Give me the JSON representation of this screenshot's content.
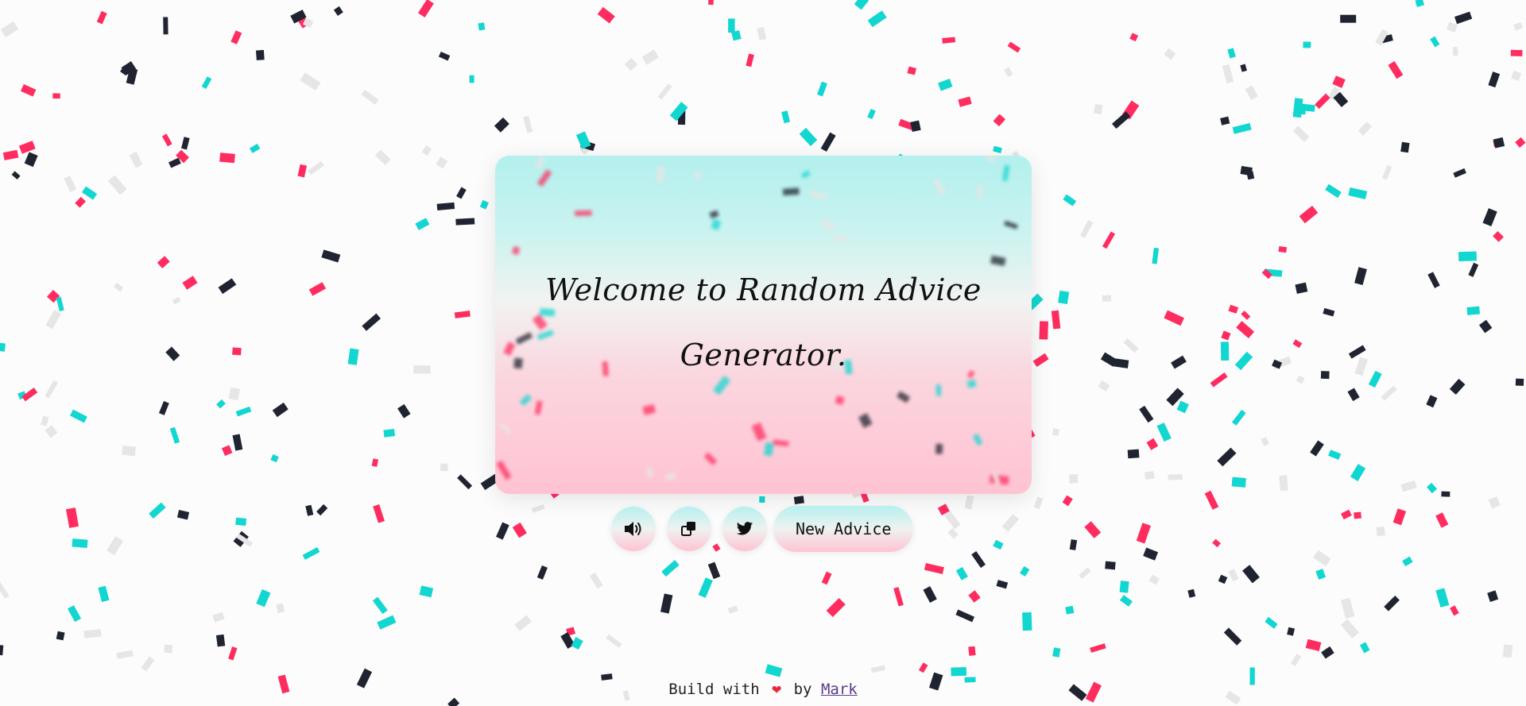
{
  "advice": {
    "text": "Welcome to Random Advice Generator."
  },
  "controls": {
    "speak_icon": "speaker-icon",
    "copy_icon": "copy-icon",
    "tweet_icon": "twitter-icon",
    "new_advice_label": "New Advice"
  },
  "footer": {
    "prefix": "Build with",
    "heart_icon": "heart-icon",
    "heart_glyph": "❤",
    "by": "by",
    "author": "Mark"
  },
  "colors": {
    "background": "#fcfcfd",
    "confetti_pink": "#ff2d5f",
    "confetti_teal": "#12d6d0",
    "confetti_dark": "#1f2430",
    "confetti_light": "#e6e6e6",
    "gradient_top": "#b3f0ee",
    "gradient_bottom": "#ffc3d2"
  }
}
